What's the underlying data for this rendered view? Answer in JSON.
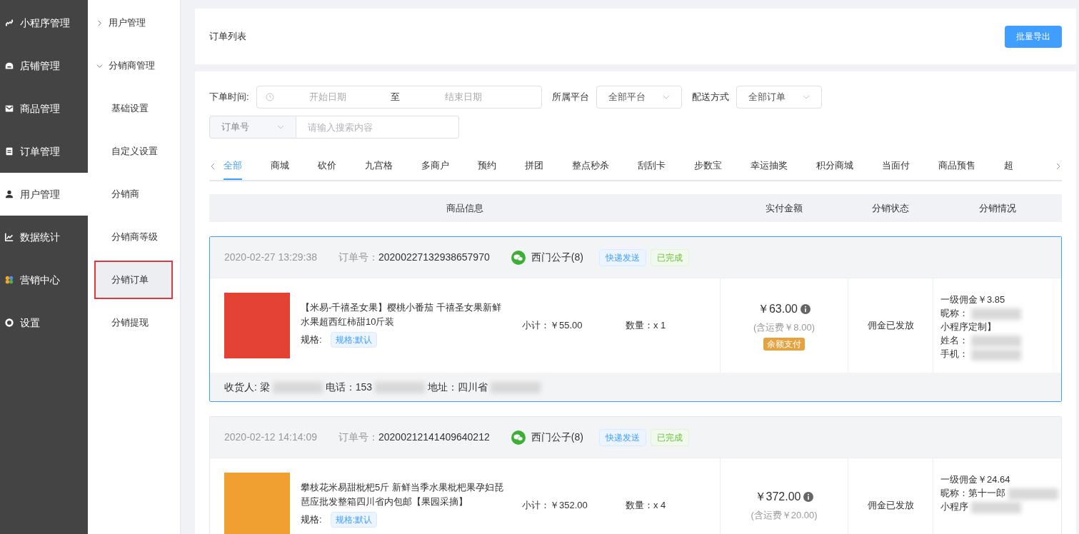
{
  "sidebar": {
    "items": [
      {
        "label": "小程序管理",
        "kind": "link",
        "selected": false
      },
      {
        "label": "店铺管理",
        "kind": "store",
        "selected": false
      },
      {
        "label": "商品管理",
        "kind": "mail",
        "selected": false
      },
      {
        "label": "订单管理",
        "kind": "clipboard",
        "selected": false
      },
      {
        "label": "用户管理",
        "kind": "user",
        "selected": true
      },
      {
        "label": "数据统计",
        "kind": "chart",
        "selected": false
      },
      {
        "label": "营销中心",
        "kind": "petals",
        "selected": false
      },
      {
        "label": "设置",
        "kind": "gear",
        "selected": false
      }
    ]
  },
  "subnav": {
    "items": [
      {
        "kind": "group",
        "label": "用户管理",
        "expanded": false
      },
      {
        "kind": "group",
        "label": "分销商管理",
        "expanded": true
      },
      {
        "kind": "item",
        "label": "基础设置",
        "selected": false
      },
      {
        "kind": "item",
        "label": "自定义设置",
        "selected": false
      },
      {
        "kind": "item",
        "label": "分销商",
        "selected": false
      },
      {
        "kind": "item",
        "label": "分销商等级",
        "selected": false
      },
      {
        "kind": "item",
        "label": "分销订单",
        "selected": true
      },
      {
        "kind": "item",
        "label": "分销提现",
        "selected": false
      }
    ]
  },
  "header": {
    "title": "订单列表",
    "export_button": "批量导出"
  },
  "filters": {
    "time_label": "下单时间:",
    "start_placeholder": "开始日期",
    "range_separator": "至",
    "end_placeholder": "结束日期",
    "platform_label": "所属平台",
    "platform_value": "全部平台",
    "delivery_label": "配送方式",
    "delivery_value": "全部订单",
    "search_type": "订单号",
    "search_placeholder": "请输入搜索内容"
  },
  "tabs": [
    {
      "label": "全部",
      "selected": true
    },
    {
      "label": "商城",
      "selected": false
    },
    {
      "label": "砍价",
      "selected": false
    },
    {
      "label": "九宫格",
      "selected": false
    },
    {
      "label": "多商户",
      "selected": false
    },
    {
      "label": "预约",
      "selected": false
    },
    {
      "label": "拼团",
      "selected": false
    },
    {
      "label": "整点秒杀",
      "selected": false
    },
    {
      "label": "刮刮卡",
      "selected": false
    },
    {
      "label": "步数宝",
      "selected": false
    },
    {
      "label": "幸运抽奖",
      "selected": false
    },
    {
      "label": "积分商城",
      "selected": false
    },
    {
      "label": "当面付",
      "selected": false
    },
    {
      "label": "商品预售",
      "selected": false
    },
    {
      "label": "超",
      "selected": false
    }
  ],
  "table": {
    "columns": [
      "商品信息",
      "实付金额",
      "分销状态",
      "分销情况"
    ]
  },
  "orders": [
    {
      "selected": true,
      "time": "2020-02-27 13:29:38",
      "order_no_label": "订单号：",
      "order_no": "20200227132938657970",
      "user": "西门公子(8)",
      "tags": [
        {
          "label": "快递发送",
          "kind": "delivery"
        },
        {
          "label": "已完成",
          "kind": "done"
        }
      ],
      "product": {
        "title": "【米易-千禧圣女果】樱桃小番茄 千禧圣女果新鲜水果超西红柿甜10斤装",
        "spec_label": "规格:",
        "spec": "规格:默认",
        "subtotal": "小计：￥55.00",
        "quantity": "数量：x 1"
      },
      "amount": "￥63.00",
      "shipping": "(含运费￥8.00)",
      "payment": "余额支付",
      "status": "佣金已发放",
      "commission": [
        {
          "text": "一级佣金￥3.85",
          "redacted": false
        },
        {
          "text": "昵称：",
          "redacted": true
        },
        {
          "text": "小程序定制】",
          "redacted": false
        },
        {
          "text": "姓名：",
          "redacted": true
        },
        {
          "text": "手机：",
          "redacted": true
        }
      ],
      "receiver": [
        {
          "text": "收货人: 梁",
          "redacted": true
        },
        {
          "text": "电话：153",
          "redacted": true
        },
        {
          "text": "地址：四川省",
          "redacted": true
        }
      ]
    },
    {
      "selected": false,
      "time": "2020-02-12 14:14:09",
      "order_no_label": "订单号：",
      "order_no": "20200212141409640212",
      "user": "西门公子(8)",
      "tags": [
        {
          "label": "快递发送",
          "kind": "delivery"
        },
        {
          "label": "已完成",
          "kind": "done"
        }
      ],
      "product": {
        "title": "攀枝花米易甜枇杷5斤 新鲜当季水果枇杷果孕妇琵琶应批发整箱四川省内包邮【果园采摘】",
        "spec_label": "规格:",
        "spec": "规格:默认",
        "subtotal": "小计：￥352.00",
        "quantity": "数量：x 4"
      },
      "amount": "￥372.00",
      "shipping": "(含运费￥20.00)",
      "status": "佣金已发放",
      "commission": [
        {
          "text": "一级佣金￥24.64",
          "redacted": false
        },
        {
          "text": "昵称：第十一郎",
          "redacted": true
        },
        {
          "text": "小程序",
          "redacted": true
        }
      ]
    }
  ]
}
